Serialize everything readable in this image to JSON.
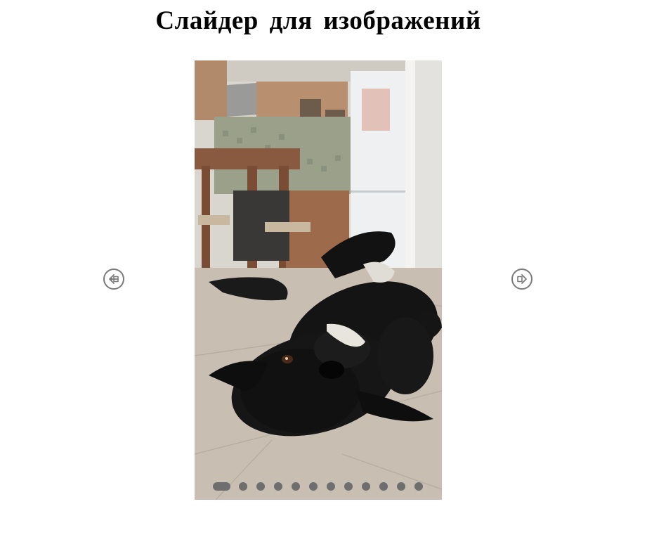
{
  "page": {
    "title": "Слайдер для изображений"
  },
  "slider": {
    "current_slide_index": 0,
    "slide_count": 12,
    "image_subject": "black dog lying upside down on a wooden floor in a kitchen",
    "prev_icon": "arrow-left-circle-icon",
    "next_icon": "arrow-right-circle-icon",
    "dots": [
      {
        "active": true
      },
      {
        "active": false
      },
      {
        "active": false
      },
      {
        "active": false
      },
      {
        "active": false
      },
      {
        "active": false
      },
      {
        "active": false
      },
      {
        "active": false
      },
      {
        "active": false
      },
      {
        "active": false
      },
      {
        "active": false
      },
      {
        "active": false
      }
    ]
  },
  "colors": {
    "dot": "#6e6e6e",
    "arrow_border": "#7a7a7a",
    "title": "#000000"
  }
}
